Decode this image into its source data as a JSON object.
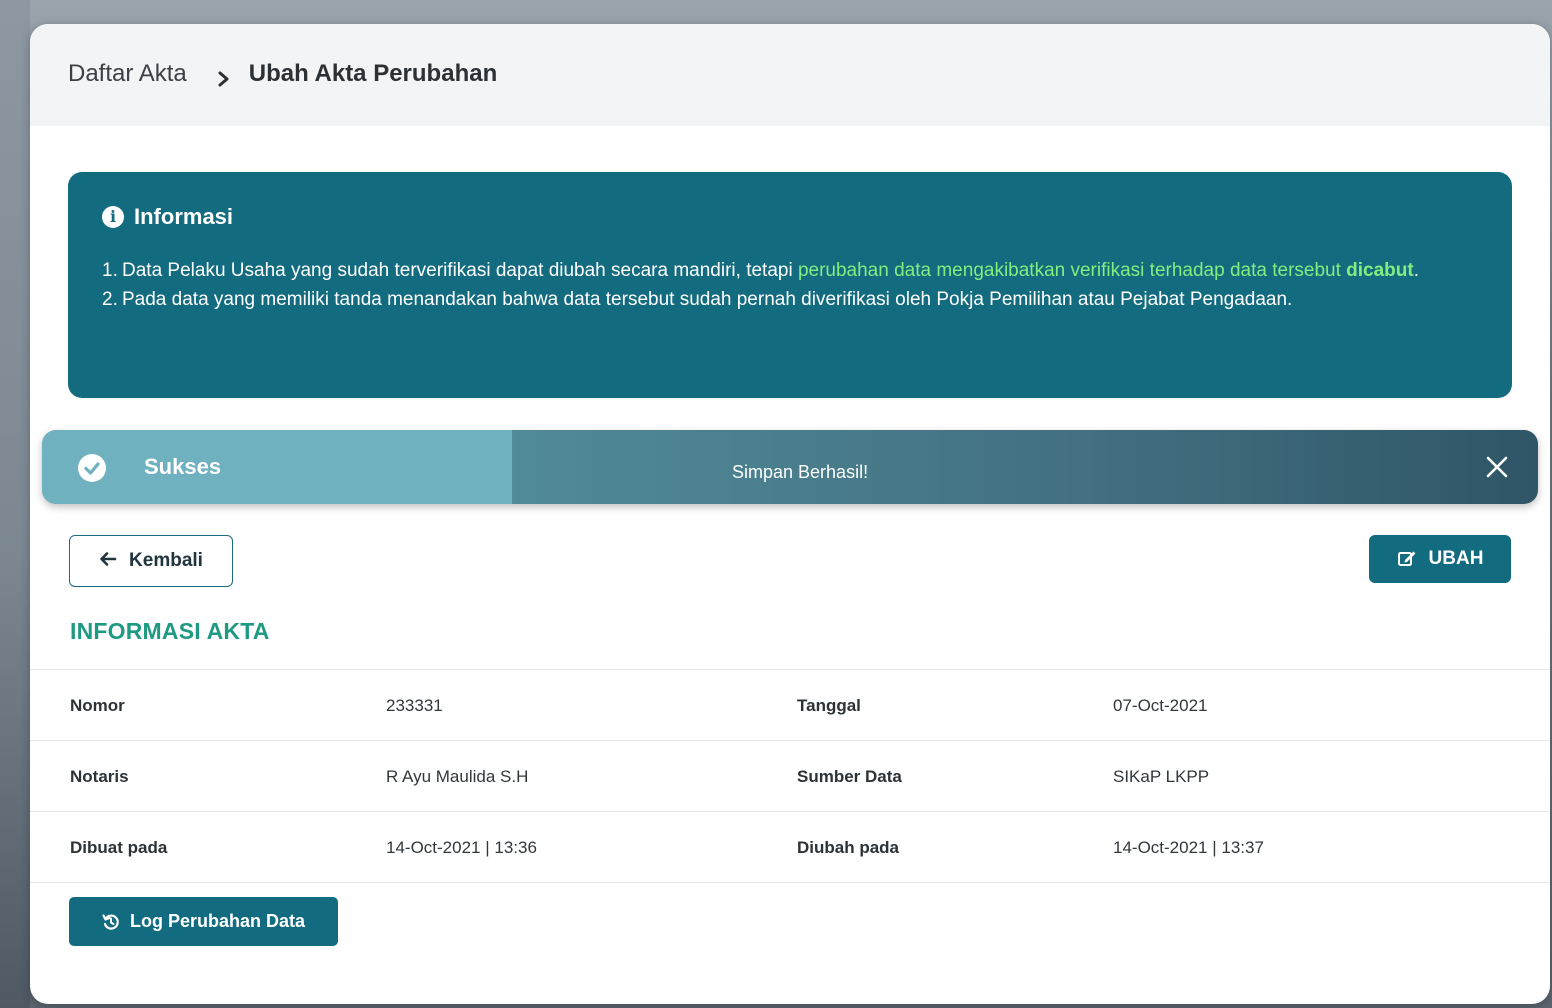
{
  "breadcrumb": {
    "root": "Daftar Akta",
    "current": "Ubah Akta Perubahan"
  },
  "info": {
    "title": "Informasi",
    "item1_num": "1.",
    "item1_text": "Data Pelaku Usaha yang sudah terverifikasi dapat diubah secara mandiri, tetapi ",
    "item1_highlight": "perubahan data mengakibatkan verifikasi terhadap data tersebut ",
    "item1_bold": "dicabut",
    "item1_end": ".",
    "item2_num": "2.",
    "item2_text": "Pada data yang memiliki tanda menandakan bahwa data tersebut sudah pernah diverifikasi oleh Pokja Pemilihan atau Pejabat Pengadaan."
  },
  "toast": {
    "title": "Sukses",
    "message": "Simpan Berhasil!"
  },
  "actions": {
    "back_label": "Kembali",
    "edit_label": "UBAH",
    "log_label": "Log Perubahan Data"
  },
  "section": {
    "title": "INFORMASI AKTA"
  },
  "details": {
    "rows": [
      {
        "label_left": "Nomor",
        "value_left": "233331",
        "label_right": "Tanggal",
        "value_right": "07-Oct-2021"
      },
      {
        "label_left": "Notaris",
        "value_left": "R Ayu Maulida S.H",
        "label_right": "Sumber Data",
        "value_right": "SIKaP LKPP"
      },
      {
        "label_left": "Dibuat pada",
        "value_left": "14-Oct-2021 | 13:36",
        "label_right": "Diubah pada",
        "value_right": "14-Oct-2021 | 13:37"
      }
    ]
  },
  "colors": {
    "primary": "#126b7f",
    "accent_green": "#1f9a82",
    "highlight": "#7ff07f"
  },
  "icons": {
    "breadcrumb_separator": "chevron-right-icon",
    "info": "info-circle-icon",
    "toast_status": "check-circle-icon",
    "toast_close": "close-icon",
    "back": "arrow-left-icon",
    "edit": "edit-icon",
    "log": "history-icon"
  }
}
